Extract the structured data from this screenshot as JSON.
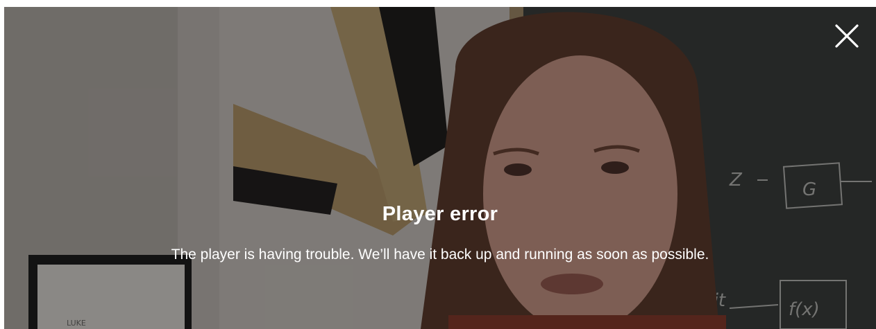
{
  "player": {
    "error_title": "Player error",
    "error_message": "The player is having trouble. We’ll have it back up and running as soon as possible.",
    "close_icon": "close-icon"
  },
  "background": {
    "chalkboard_notes": [
      "Z",
      "G",
      "init",
      "f(x)"
    ],
    "frame_text": "LUKE"
  },
  "colors": {
    "overlay_text": "#ffffff",
    "overlay_dim": "rgba(10,10,10,0.42)"
  }
}
